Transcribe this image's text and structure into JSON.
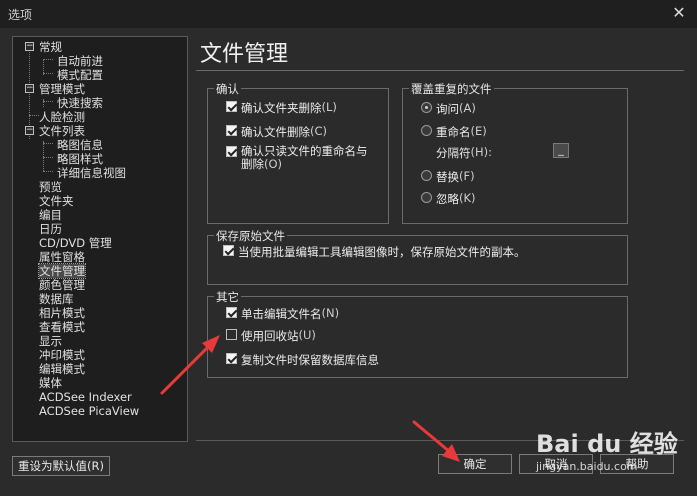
{
  "window": {
    "title": "选项"
  },
  "tree": {
    "items": [
      "常规",
      "自动前进",
      "模式配置",
      "管理模式",
      "快速搜索",
      "人脸检测",
      "文件列表",
      "略图信息",
      "略图样式",
      "详细信息视图",
      "预览",
      "文件夹",
      "编目",
      "日历",
      "CD/DVD 管理",
      "属性窗格",
      "文件管理",
      "颜色管理",
      "数据库",
      "相片模式",
      "查看模式",
      "显示",
      "冲印模式",
      "编辑模式",
      "媒体",
      "ACDSee Indexer",
      "ACDSee PicaView"
    ],
    "selected": "文件管理"
  },
  "page": {
    "title": "文件管理"
  },
  "confirm": {
    "legend": "确认",
    "delete_folder": "确认文件夹删除",
    "delete_folder_key": "(L)",
    "delete_file": "确认文件删除",
    "delete_file_key": "(C)",
    "readonly_line1": "确认只读文件的重命名与",
    "readonly_line2": "删除",
    "readonly_key": "(O)"
  },
  "overwrite": {
    "legend": "覆盖重复的文件",
    "ask": "询问",
    "ask_key": "(A)",
    "rename": "重命名",
    "rename_key": "(E)",
    "separator_label": "分隔符",
    "separator_key": "(H):",
    "separator_value": "_",
    "replace": "替换",
    "replace_key": "(F)",
    "ignore": "忽略",
    "ignore_key": "(K)"
  },
  "original": {
    "legend": "保存原始文件",
    "keep_copy": "当使用批量编辑工具编辑图像时，保存原始文件的副本。"
  },
  "other": {
    "legend": "其它",
    "single_click_rename": "单击编辑文件名",
    "single_click_rename_key": "(N)",
    "use_recycle_bin": "使用回收站",
    "use_recycle_bin_key": "(U)",
    "keep_db_info": "复制文件时保留数据库信息"
  },
  "buttons": {
    "reset": "重设为默认值(R)",
    "ok": "确定",
    "cancel": "取消",
    "help": "帮助"
  },
  "watermark": {
    "brand": "Bai du 经验",
    "url": "jingyan.baidu.com"
  },
  "colors": {
    "background": "#2b2b2b",
    "tree_background": "#1e1e1e",
    "arrow": "#e83a3a"
  }
}
